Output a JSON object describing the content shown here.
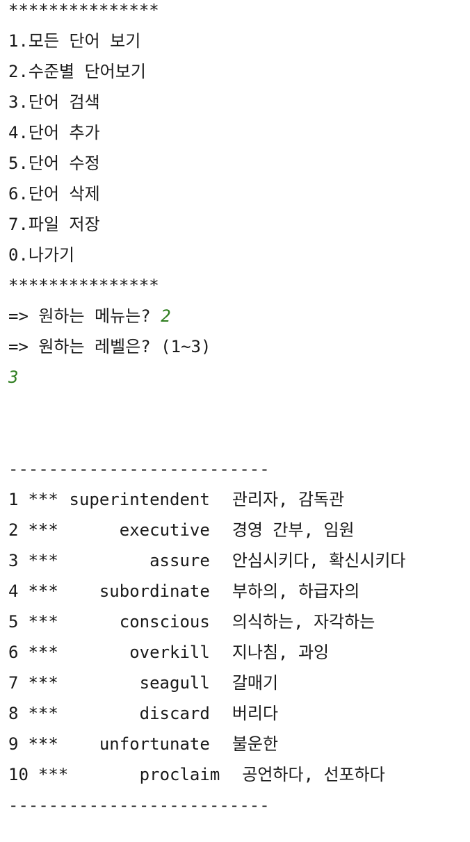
{
  "menu": {
    "border_top": "***************",
    "items": [
      "1.모든 단어 보기",
      "2.수준별 단어보기",
      "3.단어 검색",
      "4.단어 추가",
      "5.단어 수정",
      "6.단어 삭제",
      "7.파일 저장",
      "0.나가기"
    ],
    "border_bottom": "***************"
  },
  "prompts": {
    "menu_prompt": "=> 원하는 메뉴는? ",
    "menu_input": "2",
    "level_prompt": "=> 원하는 레벨은? (1~3)",
    "level_input": "3"
  },
  "word_list": {
    "separator_top": "--------------------------",
    "rows": [
      {
        "index": "1",
        "level": "***",
        "word": "superintendent",
        "meaning": "관리자, 감독관"
      },
      {
        "index": "2",
        "level": "***",
        "word": "executive",
        "meaning": "경영 간부, 임원"
      },
      {
        "index": "3",
        "level": "***",
        "word": "assure",
        "meaning": "안심시키다, 확신시키다"
      },
      {
        "index": "4",
        "level": "***",
        "word": "subordinate",
        "meaning": "부하의, 하급자의"
      },
      {
        "index": "5",
        "level": "***",
        "word": "conscious",
        "meaning": "의식하는, 자각하는"
      },
      {
        "index": "6",
        "level": "***",
        "word": "overkill",
        "meaning": "지나침, 과잉"
      },
      {
        "index": "7",
        "level": "***",
        "word": "seagull",
        "meaning": "갈매기"
      },
      {
        "index": "8",
        "level": "***",
        "word": "discard",
        "meaning": "버리다"
      },
      {
        "index": "9",
        "level": "***",
        "word": "unfortunate",
        "meaning": "불운한"
      },
      {
        "index": "10",
        "level": "***",
        "word": "proclaim",
        "meaning": "공언하다, 선포하다"
      }
    ],
    "separator_bottom": "--------------------------"
  }
}
